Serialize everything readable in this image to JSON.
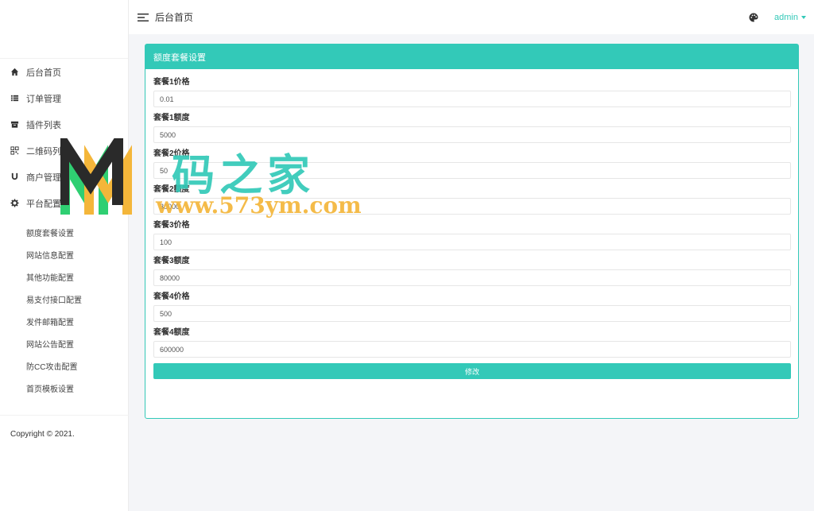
{
  "header": {
    "title": "后台首页",
    "user": "admin"
  },
  "sidebar": {
    "items": [
      {
        "label": "后台首页",
        "icon": "home-icon"
      },
      {
        "label": "订单管理",
        "icon": "list-icon"
      },
      {
        "label": "插件列表",
        "icon": "box-icon"
      },
      {
        "label": "二维码列表",
        "icon": "qrcode-icon"
      },
      {
        "label": "商户管理",
        "icon": "magnet-icon"
      },
      {
        "label": "平台配置",
        "icon": "gear-icon"
      }
    ],
    "sub_items": [
      "额度套餐设置",
      "网站信息配置",
      "其他功能配置",
      "易支付接口配置",
      "发件邮箱配置",
      "网站公告配置",
      "防CC攻击配置",
      "首页模板设置"
    ],
    "copyright": "Copyright © 2021."
  },
  "panel": {
    "title": "额度套餐设置",
    "fields": [
      {
        "label": "套餐1价格",
        "value": "0.01"
      },
      {
        "label": "套餐1额度",
        "value": "5000"
      },
      {
        "label": "套餐2价格",
        "value": "50"
      },
      {
        "label": "套餐2额度",
        "value": "30000"
      },
      {
        "label": "套餐3价格",
        "value": "100"
      },
      {
        "label": "套餐3额度",
        "value": "80000"
      },
      {
        "label": "套餐4价格",
        "value": "500"
      },
      {
        "label": "套餐4额度",
        "value": "600000"
      }
    ],
    "submit_label": "修改"
  },
  "watermark": {
    "text_cn": "码之家",
    "url": "www.573ym.com"
  },
  "colors": {
    "accent": "#33c9b8",
    "watermark_yellow": "#f4b63a"
  }
}
